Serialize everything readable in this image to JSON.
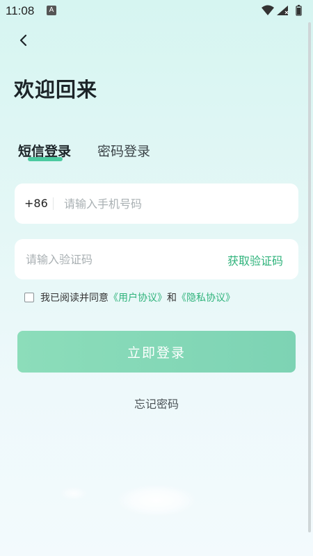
{
  "status_bar": {
    "time": "11:08",
    "notification_badge": "A"
  },
  "page": {
    "title": "欢迎回来"
  },
  "tabs": [
    {
      "label": "短信登录",
      "active": true
    },
    {
      "label": "密码登录",
      "active": false
    }
  ],
  "phone": {
    "country_code": "+86",
    "placeholder": "请输入手机号码",
    "value": ""
  },
  "code": {
    "placeholder": "请输入验证码",
    "value": "",
    "get_code_label": "获取验证码"
  },
  "agreement": {
    "checked": false,
    "prefix": "我已阅读并同意",
    "user_agreement": "《用户协议》",
    "conjunction": "和",
    "privacy_agreement": "《隐私协议》"
  },
  "actions": {
    "login_label": "立即登录",
    "forgot_label": "忘记密码"
  },
  "colors": {
    "accent": "#2fb37b",
    "tab_indicator": "#4ccaa0",
    "login_button": "#82d8b7"
  }
}
